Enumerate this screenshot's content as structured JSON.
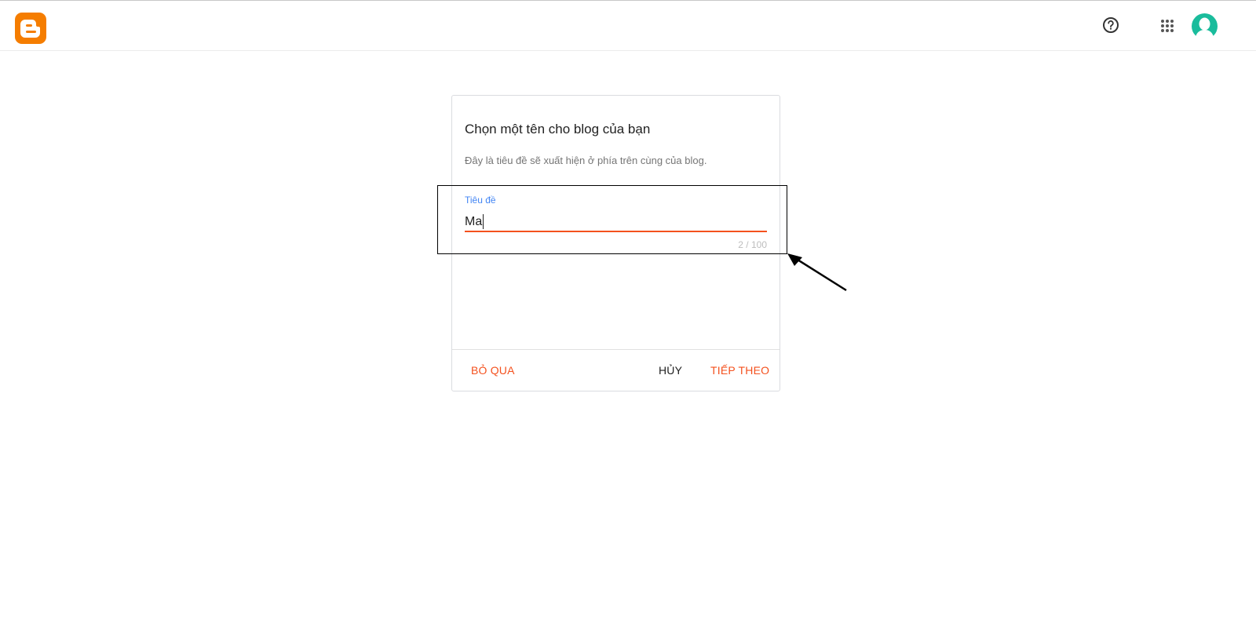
{
  "header": {
    "logo_icon": "blogger-logo-icon",
    "help_icon": "help-circle-icon",
    "apps_icon": "apps-grid-icon",
    "avatar_icon": "account-avatar-icon",
    "brand_color": "#f57d00",
    "avatar_color": "#1abc9c"
  },
  "dialog": {
    "title": "Chọn một tên cho blog của bạn",
    "subtitle": "Đây là tiêu đề sẽ xuất hiện ở phía trên cùng của blog.",
    "field": {
      "label": "Tiêu đề",
      "value": "Ma",
      "counter": "2 / 100"
    },
    "buttons": {
      "skip": "BỎ QUA",
      "cancel": "HỦY",
      "next": "TIẾP THEO"
    },
    "accent_color": "#f4511e"
  }
}
